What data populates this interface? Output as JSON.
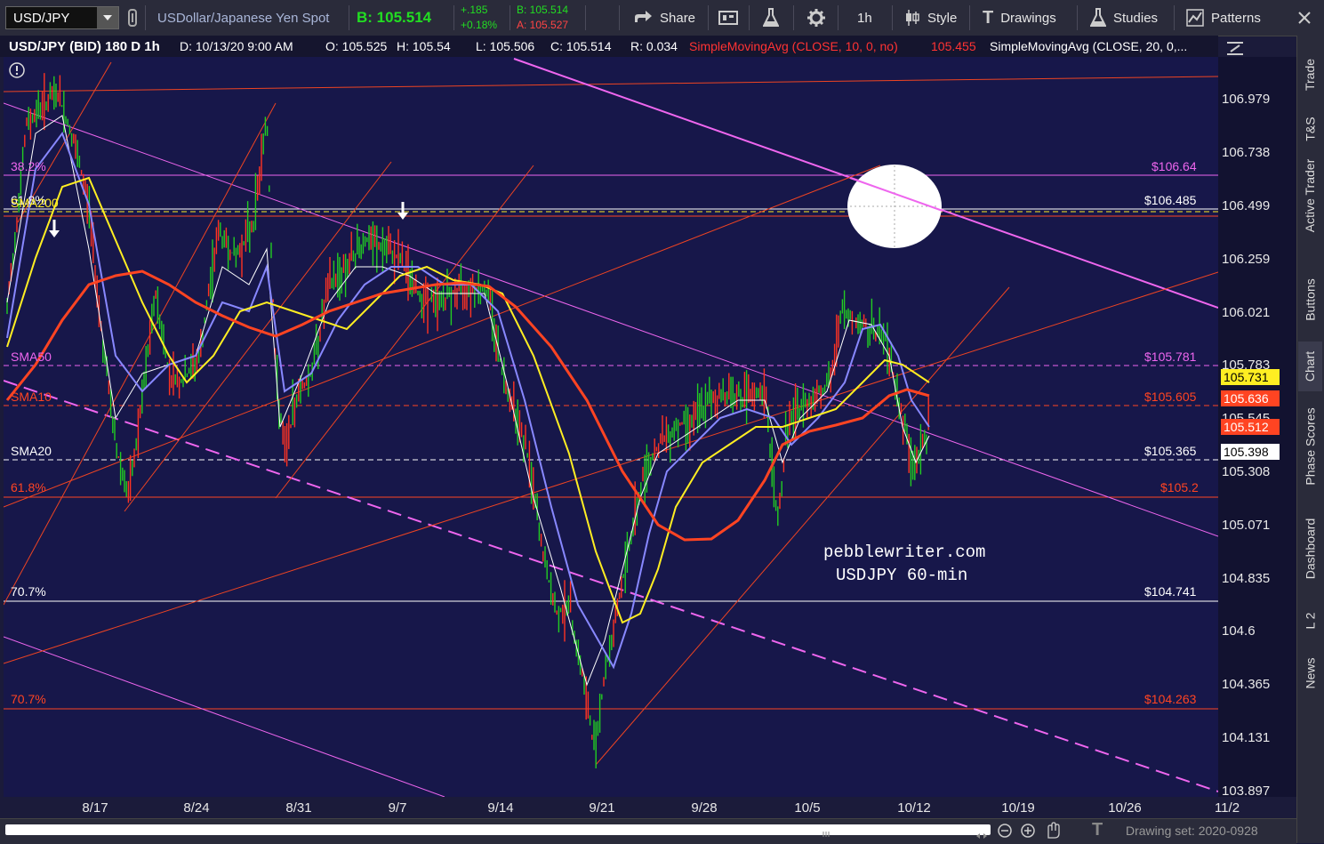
{
  "toolbar": {
    "symbol": "USD/JPY",
    "description": "USDollar/Japanese Yen Spot",
    "bid_label": "B: 105.514",
    "change": "+.185",
    "change_pct": "+0.18%",
    "bid_small": "B: 105.514",
    "ask_small": "A: 105.527",
    "share": "Share",
    "interval": "1h",
    "style": "Style",
    "drawings": "Drawings",
    "studies": "Studies",
    "patterns": "Patterns"
  },
  "infobar": {
    "title": "USD/JPY (BID) 180 D 1h",
    "date": "D: 10/13/20 9:00 AM",
    "open": "O: 105.525",
    "high": "H: 105.54",
    "low": "L: 105.506",
    "close": "C: 105.514",
    "range": "R: 0.034",
    "sma10": "SimpleMovingAvg (CLOSE, 10, 0, no)",
    "sma10_val": "105.455",
    "sma20": "SimpleMovingAvg (CLOSE, 20, 0,..."
  },
  "yaxis": [
    "106.979",
    "106.738",
    "106.499",
    "106.259",
    "106.021",
    "105.783",
    "105.545",
    "105.308",
    "105.071",
    "104.835",
    "104.6",
    "104.365",
    "104.131",
    "103.897"
  ],
  "xaxis": [
    "8/17",
    "8/24",
    "8/31",
    "9/7",
    "9/14",
    "9/21",
    "9/28",
    "10/5",
    "10/12",
    "10/19",
    "10/26",
    "11/2"
  ],
  "levels": {
    "fib382": "38.2%",
    "fib618a": "61.8%",
    "fib618_overlap": "SMA200",
    "sma50": "SMA50",
    "sma10": "SMA10",
    "sma20": "SMA20",
    "fib618b": "61.8%",
    "fib707a": "70.7%",
    "fib707b": "70.7%",
    "p10664": "$106.64",
    "p10648": "$106.485",
    "p10578": "$105.781",
    "p10560": "$105.605",
    "p10536": "$105.365",
    "p1052": "$105.2",
    "p10474": "$104.741",
    "p10426": "$104.263"
  },
  "badges": {
    "yellow": "105.731",
    "red1": "105.636",
    "red2": "105.512",
    "white": "105.398"
  },
  "watermark": {
    "line1": "pebblewriter.com",
    "line2": "USDJPY 60-min"
  },
  "sidebar": [
    "Trade",
    "T&S",
    "Active Trader",
    "Buttons",
    "Chart",
    "Phase Scores",
    "Dashboard",
    "L 2",
    "News"
  ],
  "footer": {
    "drawing_set": "Drawing set: 2020-0928"
  },
  "colors": {
    "background": "#17174a",
    "price": "#22cc22",
    "sma200": "#ff4422",
    "sma50": "#ffee22",
    "sma20": "#8888ff",
    "sma10": "#ffffff",
    "magenta": "#ee66ee",
    "orange_line": "#ee4422"
  }
}
